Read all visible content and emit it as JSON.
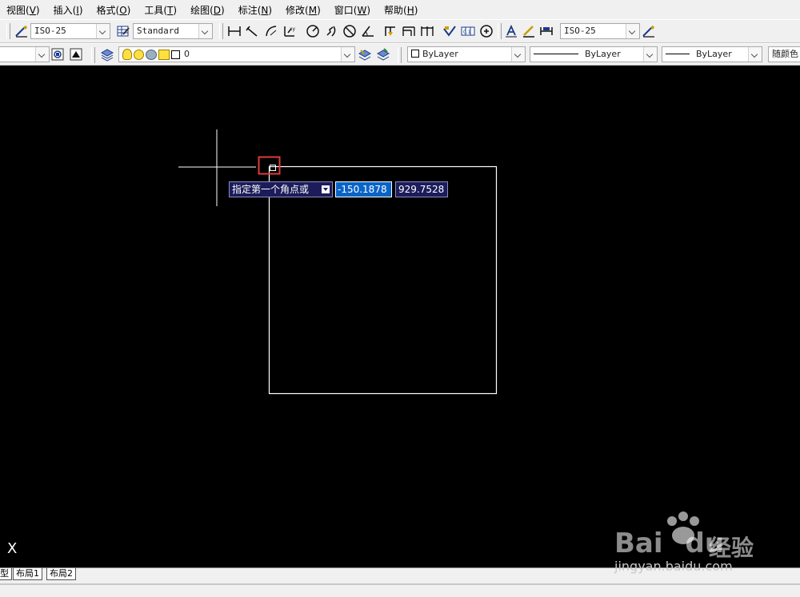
{
  "menu": [
    {
      "label": "视图(",
      "key": "V",
      "end": ")"
    },
    {
      "label": "插入(",
      "key": "I",
      "end": ")"
    },
    {
      "label": "格式(",
      "key": "O",
      "end": ")"
    },
    {
      "label": "工具(",
      "key": "T",
      "end": ")"
    },
    {
      "label": "绘图(",
      "key": "D",
      "end": ")"
    },
    {
      "label": "标注(",
      "key": "N",
      "end": ")"
    },
    {
      "label": "修改(",
      "key": "M",
      "end": ")"
    },
    {
      "label": "窗口(",
      "key": "W",
      "end": ")"
    },
    {
      "label": "帮助(",
      "key": "H",
      "end": ")"
    }
  ],
  "toolbar": {
    "text_style": "ISO-25",
    "table_style": "Standard",
    "dim_style": "ISO-25"
  },
  "props": {
    "layer": "0",
    "color": "ByLayer",
    "linetype": "ByLayer",
    "lineweight": "ByLayer",
    "plotstyle": "随颜色"
  },
  "dynamic_input": {
    "prompt": "指定第一个角点或",
    "x_value": "-150.1878",
    "y_value": "929.7528"
  },
  "tabs": [
    "型",
    "布局1",
    "布局2"
  ],
  "ucs_label": "X",
  "watermark": {
    "brand": "Bai",
    "brand2": "du",
    "suffix": "经验",
    "url": "jingyan.baidu.com"
  },
  "colors": {
    "canvas": "#000000",
    "highlight": "#e03a3a",
    "input_select": "#0a64c8"
  }
}
